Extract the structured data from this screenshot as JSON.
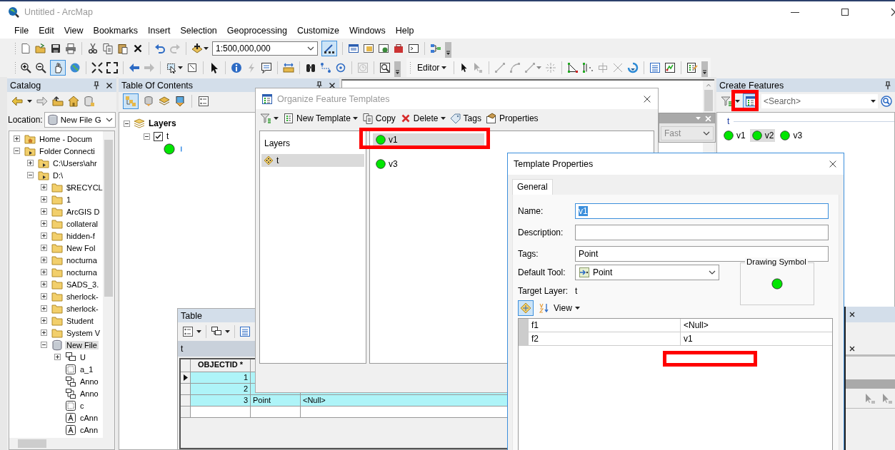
{
  "window": {
    "title": "Untitled - ArcMap"
  },
  "menu": [
    "File",
    "Edit",
    "View",
    "Bookmarks",
    "Insert",
    "Selection",
    "Geoprocessing",
    "Customize",
    "Windows",
    "Help"
  ],
  "standard_toolbar": {
    "scale": "1:500,000,000",
    "editor_toolbar_pressed": true
  },
  "tools_toolbar": {
    "pan_pressed": true
  },
  "editor_toolbar": {
    "menu": "Editor"
  },
  "catalog": {
    "title": "Catalog",
    "location_label": "Location:",
    "location": "New File G",
    "tree": [
      {
        "label": "Home - Docum",
        "kind": "home",
        "expanded": false,
        "selected": false
      },
      {
        "label": "Folder Connecti",
        "kind": "connections",
        "expanded": true,
        "selected": false,
        "children": [
          {
            "label": "C:\\Users\\ahr",
            "kind": "connection",
            "expanded": false,
            "selected": false
          },
          {
            "label": "D:\\",
            "kind": "connection",
            "expanded": true,
            "selected": false,
            "children": [
              {
                "label": "$RECYCL",
                "kind": "folder",
                "expanded": false,
                "selected": false
              },
              {
                "label": "1",
                "kind": "folder",
                "expanded": false,
                "selected": false
              },
              {
                "label": "ArcGIS D",
                "kind": "folder",
                "expanded": false,
                "selected": false
              },
              {
                "label": "collateral",
                "kind": "folder",
                "expanded": false,
                "selected": false
              },
              {
                "label": "hidden-f",
                "kind": "folder",
                "expanded": false,
                "selected": false
              },
              {
                "label": "New Fol",
                "kind": "folder",
                "expanded": false,
                "selected": false
              },
              {
                "label": "nocturna",
                "kind": "folder",
                "expanded": false,
                "selected": false
              },
              {
                "label": "nocturna",
                "kind": "folder",
                "expanded": false,
                "selected": false
              },
              {
                "label": "SADS_3.",
                "kind": "folder",
                "expanded": false,
                "selected": false
              },
              {
                "label": "sherlock-",
                "kind": "folder",
                "expanded": false,
                "selected": false
              },
              {
                "label": "sherlock-",
                "kind": "folder",
                "expanded": false,
                "selected": false
              },
              {
                "label": "Student",
                "kind": "folder",
                "expanded": false,
                "selected": false
              },
              {
                "label": "System V",
                "kind": "folder",
                "expanded": false,
                "selected": false
              },
              {
                "label": "New File",
                "kind": "geodatabase",
                "expanded": true,
                "selected": true,
                "children": [
                  {
                    "label": "U",
                    "kind": "dataset",
                    "expanded": false,
                    "selected": false
                  },
                  {
                    "label": "a_1",
                    "kind": "raster",
                    "selected": false
                  },
                  {
                    "label": "Anno",
                    "kind": "relationship",
                    "selected": false
                  },
                  {
                    "label": "Anno",
                    "kind": "relationship",
                    "selected": false
                  },
                  {
                    "label": "c",
                    "kind": "raster",
                    "selected": false
                  },
                  {
                    "label": "cAnn",
                    "kind": "annotation",
                    "selected": false
                  },
                  {
                    "label": "cAnn",
                    "kind": "annotation",
                    "selected": false
                  }
                ]
              }
            ]
          }
        ]
      }
    ]
  },
  "table_of_contents": {
    "title": "Table Of Contents",
    "list_by_drawing_order_pressed": true,
    "root": {
      "label": "Layers",
      "expanded": true,
      "layers": [
        {
          "label": "t",
          "visible": true,
          "expanded": true
        }
      ]
    }
  },
  "create_features": {
    "title": "Create Features",
    "organize_pressed": true,
    "search": {
      "placeholder": "<Search>"
    },
    "group": "t",
    "templates": [
      {
        "label": "v1",
        "selected": false
      },
      {
        "label": "v2",
        "selected": true
      },
      {
        "label": "v3",
        "selected": false
      }
    ]
  },
  "table_window": {
    "title": "Table",
    "tab": "t",
    "columns": [
      "OBJECTID *"
    ],
    "rows": [
      {
        "current": true,
        "selected": true,
        "cells": [
          "1"
        ]
      },
      {
        "current": false,
        "selected": true,
        "cells": [
          "2"
        ]
      },
      {
        "current": false,
        "selected": true,
        "cells": [
          "3",
          "Point",
          "<Null>"
        ]
      }
    ]
  },
  "organize_window": {
    "title": "Organize Feature Templates",
    "toolbar": [
      {
        "kind": "new",
        "label": "New Template",
        "dropdown": true
      },
      {
        "kind": "copy",
        "label": "Copy",
        "dropdown": false
      },
      {
        "kind": "delete",
        "label": "Delete",
        "dropdown": true
      },
      {
        "kind": "tags",
        "label": "Tags",
        "dropdown": false
      },
      {
        "kind": "properties",
        "label": "Properties",
        "dropdown": false
      }
    ],
    "layers_heading": "Layers",
    "layers": [
      {
        "label": "t",
        "selected": true
      }
    ],
    "templates": [
      {
        "label": "v1",
        "selected": true
      },
      {
        "label": "v3",
        "selected": false
      }
    ]
  },
  "display_panel": {
    "value": "Fast"
  },
  "template_properties": {
    "title": "Template Properties",
    "tabs": [
      {
        "label": "General",
        "selected": true
      }
    ],
    "fields": [
      {
        "kind": "text",
        "label": "Name:",
        "value": "v1",
        "focused": true
      },
      {
        "kind": "text",
        "label": "Description:",
        "focused": false
      },
      {
        "kind": "text",
        "label": "Tags:",
        "value": "Point",
        "focused": false
      },
      {
        "kind": "dropdown",
        "label": "Default Tool:",
        "value": "Point",
        "focused": false
      }
    ],
    "target_layer_label": "Target Layer:",
    "target_layer": "t",
    "symbol_group": "Drawing Symbol",
    "categorized_pressed": true,
    "view_menu": "View",
    "attributes": [
      {
        "field": "f1",
        "value": "<Null>"
      },
      {
        "field": "f2",
        "value": "v1"
      }
    ]
  }
}
